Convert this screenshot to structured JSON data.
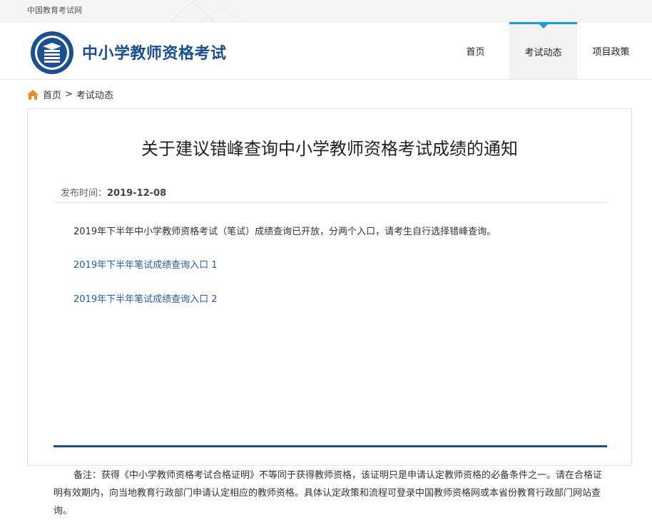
{
  "topbar": {
    "site_name": "中国教育考试网"
  },
  "header": {
    "title": "中小学教师资格考试",
    "nav": [
      "首页",
      "考试动态",
      "项目政策"
    ],
    "active_nav": "考试动态"
  },
  "breadcrumb": {
    "home": "首页",
    "separator": ">",
    "current": "考试动态"
  },
  "article": {
    "title": "关于建议错峰查询中小学教师资格考试成绩的通知",
    "meta_label": "发布时间：",
    "meta_date": "2019-12-08",
    "intro": "2019年下半年中小学教师资格考试（笔试）成绩查询已开放，分两个入口，请考生自行选择错峰查询。",
    "links": [
      "2019年下半年笔试成绩查询入口 1",
      "2019年下半年笔试成绩查询入口 2"
    ],
    "note": "备注：获得《中小学教师资格考试合格证明》不等同于获得教师资格，该证明只是申请认定教师资格的必备条件之一。请在合格证明有效期内，向当地教育行政部门申请认定相应的教师资格。具体认定政策和流程可登录中国教师资格网或本省份教育行政部门网站查询。"
  },
  "colors": {
    "brand": "#1b4f91",
    "accent": "#1a9cdc",
    "home_icon": "#f08a24",
    "link": "#2a5aa0"
  },
  "icons": {
    "home": "home-icon",
    "logo": "logo-emblem"
  }
}
